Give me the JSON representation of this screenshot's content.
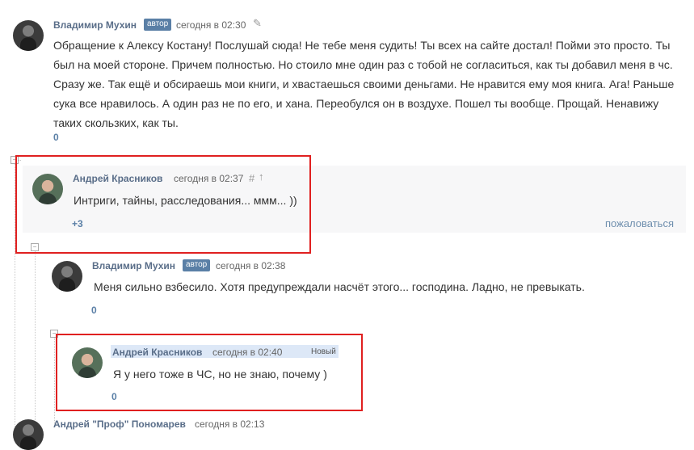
{
  "comments": [
    {
      "author": "Владимир Мухин",
      "badge": "автор",
      "time": "сегодня в 02:30",
      "text": "Обращение к Алексу Костану! Послушай сюда! Не тебе меня судить! Ты всех на сайте достал! Пойми это просто. Ты был на моей стороне. Причем полностью. Но стоило мне один раз с тобой не согласиться, как ты добавил меня в чс. Сразу же. Так ещё и обсираешь мои книги, и хвастаешься своими деньгами. Не нравится ему моя книга. Ага! Раньше сука все нравилось. А один раз не по его, и хана. Переобулся он в воздухе. Пошел ты вообще. Прощай. Ненавижу таких скользких, как ты.",
      "votes": "0",
      "edit_icon": "pencil-icon"
    },
    {
      "author": "Андрей Красников",
      "time": "сегодня в 02:37",
      "anchor": "#",
      "up_arrow": "↑",
      "text": "Интриги, тайны, расследования... ммм... ))",
      "votes": "+3",
      "report": "пожаловаться"
    },
    {
      "author": "Владимир Мухин",
      "badge": "автор",
      "time": "сегодня в 02:38",
      "text": "Меня сильно взбесило. Хотя предупреждали насчёт этого... господина. Ладно, не превыкать.",
      "votes": "0"
    },
    {
      "author": "Андрей Красников",
      "time": "сегодня в 02:40",
      "new_label": "Новый",
      "text": "Я у него тоже в ЧС, но не знаю, почему )",
      "votes": "0"
    },
    {
      "author": "Андрей \"Проф\" Пономарев",
      "time": "сегодня в 02:13"
    }
  ],
  "colors": {
    "highlight_border": "#e02020",
    "author": "#5a6e89",
    "badge_bg": "#5a7fa6",
    "new_highlight": "#dde8f7"
  }
}
